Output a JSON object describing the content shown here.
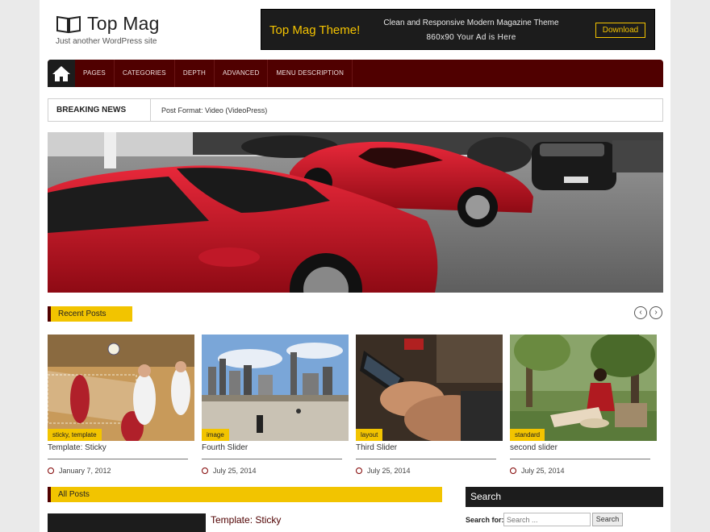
{
  "site": {
    "title": "Top Mag",
    "tagline": "Just another WordPress site"
  },
  "ad": {
    "title": "Top Mag Theme!",
    "line1": "Clean and Responsive Modern Magazine Theme",
    "line2": "860x90 Your Ad is Here",
    "button": "Download"
  },
  "nav": {
    "items": [
      "PAGES",
      "CATEGORIES",
      "DEPTH",
      "ADVANCED",
      "MENU DESCRIPTION"
    ]
  },
  "breaking": {
    "label": "BREAKING NEWS",
    "text": "Post Format: Video (VideoPress)"
  },
  "recent": {
    "heading": "Recent Posts",
    "prev": "‹",
    "next": "›",
    "posts": [
      {
        "tag": "sticky, template",
        "title": "Template: Sticky",
        "date": "January 7, 2012"
      },
      {
        "tag": "image",
        "title": "Fourth Slider",
        "date": "July 25, 2014"
      },
      {
        "tag": "layout",
        "title": "Third Slider",
        "date": "July 25, 2014"
      },
      {
        "tag": "standard",
        "title": "second slider",
        "date": "July 25, 2014"
      }
    ]
  },
  "allposts": {
    "heading": "All Posts",
    "first_title": "Template: Sticky"
  },
  "search": {
    "heading": "Search",
    "label": "Search for:",
    "placeholder": "Search ...",
    "button": "Search"
  },
  "colors": {
    "accent": "#f2c400",
    "brand": "#500000",
    "dark": "#1c1c1c"
  }
}
